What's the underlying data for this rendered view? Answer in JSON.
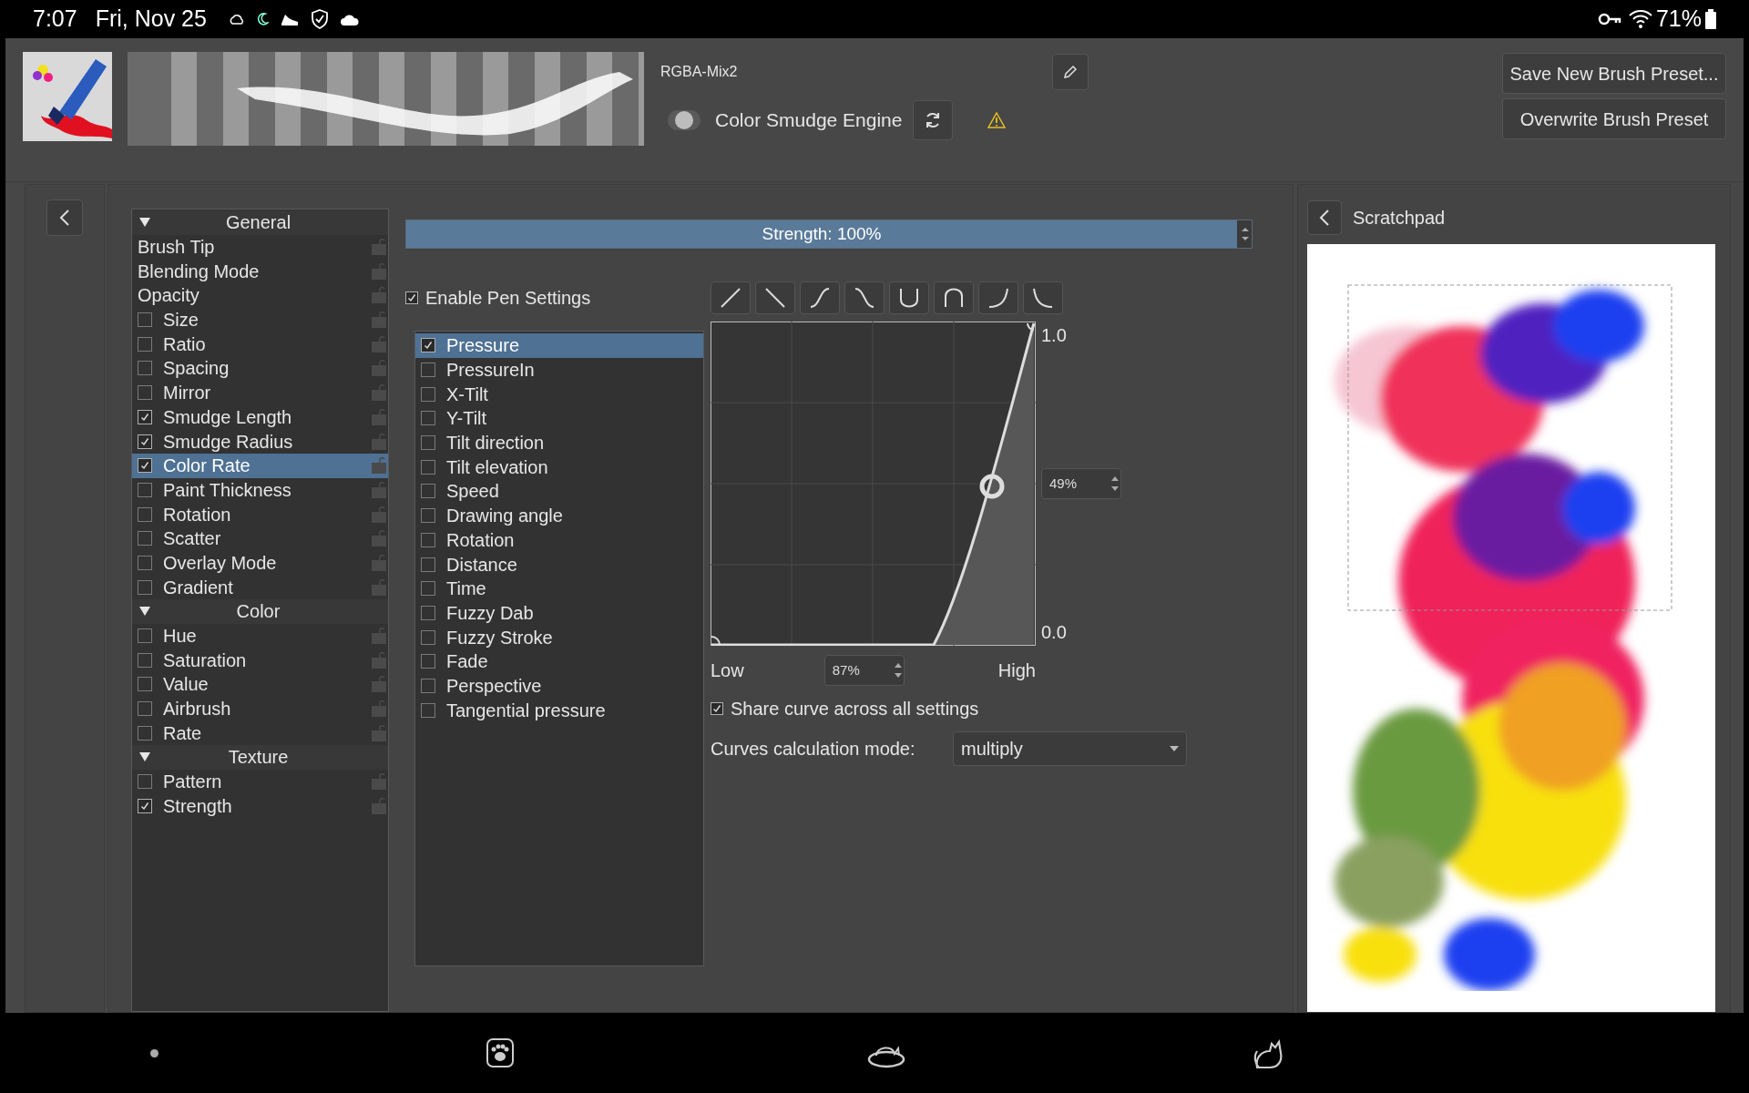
{
  "status_bar": {
    "time": "7:07",
    "date": "Fri, Nov 25",
    "battery": "71%"
  },
  "toolbar": {
    "preset_name": "RGBA-Mix2",
    "engine": {
      "label": "Color Smudge Engine",
      "on": false
    },
    "save_new": "Save New Brush Preset...",
    "overwrite": "Overwrite Brush Preset"
  },
  "options": [
    {
      "title": "General",
      "expanded": true,
      "items": [
        {
          "label": "Brush Tip",
          "kind": "plain",
          "selected": false
        },
        {
          "label": "Blending Mode",
          "kind": "plain",
          "selected": false
        },
        {
          "label": "Opacity",
          "kind": "plain",
          "selected": false
        },
        {
          "label": "Size",
          "kind": "checkbox",
          "checked": false,
          "selected": false
        },
        {
          "label": "Ratio",
          "kind": "checkbox",
          "checked": false,
          "selected": false
        },
        {
          "label": "Spacing",
          "kind": "checkbox",
          "checked": false,
          "selected": false
        },
        {
          "label": "Mirror",
          "kind": "checkbox",
          "checked": false,
          "selected": false
        },
        {
          "label": "Smudge Length",
          "kind": "checkbox",
          "checked": true,
          "selected": false
        },
        {
          "label": "Smudge Radius",
          "kind": "checkbox",
          "checked": true,
          "selected": false
        },
        {
          "label": "Color Rate",
          "kind": "checkbox",
          "checked": true,
          "selected": true
        },
        {
          "label": "Paint Thickness",
          "kind": "checkbox",
          "checked": false,
          "selected": false
        },
        {
          "label": "Rotation",
          "kind": "checkbox",
          "checked": false,
          "selected": false
        },
        {
          "label": "Scatter",
          "kind": "checkbox",
          "checked": false,
          "selected": false
        },
        {
          "label": "Overlay Mode",
          "kind": "checkbox",
          "checked": false,
          "selected": false
        },
        {
          "label": "Gradient",
          "kind": "checkbox",
          "checked": false,
          "selected": false
        }
      ]
    },
    {
      "title": "Color",
      "expanded": true,
      "items": [
        {
          "label": "Hue",
          "kind": "checkbox",
          "checked": false,
          "selected": false
        },
        {
          "label": "Saturation",
          "kind": "checkbox",
          "checked": false,
          "selected": false
        },
        {
          "label": "Value",
          "kind": "checkbox",
          "checked": false,
          "selected": false
        },
        {
          "label": "Airbrush",
          "kind": "checkbox",
          "checked": false,
          "selected": false
        },
        {
          "label": "Rate",
          "kind": "checkbox",
          "checked": false,
          "selected": false
        }
      ]
    },
    {
      "title": "Texture",
      "expanded": true,
      "items": [
        {
          "label": "Pattern",
          "kind": "checkbox",
          "checked": false,
          "selected": false
        },
        {
          "label": "Strength",
          "kind": "checkbox",
          "checked": true,
          "selected": false
        }
      ]
    }
  ],
  "strength": {
    "label": "Strength: 100%",
    "level": 1
  },
  "pen_settings": {
    "label": "Enable Pen Settings",
    "checked": true
  },
  "sensors": [
    {
      "label": "Pressure",
      "checked": true,
      "selected": true
    },
    {
      "label": "PressureIn",
      "checked": false,
      "selected": false
    },
    {
      "label": "X-Tilt",
      "checked": false,
      "selected": false
    },
    {
      "label": "Y-Tilt",
      "checked": false,
      "selected": false
    },
    {
      "label": "Tilt direction",
      "checked": false,
      "selected": false
    },
    {
      "label": "Tilt elevation",
      "checked": false,
      "selected": false
    },
    {
      "label": "Speed",
      "checked": false,
      "selected": false
    },
    {
      "label": "Drawing angle",
      "checked": false,
      "selected": false
    },
    {
      "label": "Rotation",
      "checked": false,
      "selected": false
    },
    {
      "label": "Distance",
      "checked": false,
      "selected": false
    },
    {
      "label": "Time",
      "checked": false,
      "selected": false
    },
    {
      "label": "Fuzzy Dab",
      "checked": false,
      "selected": false
    },
    {
      "label": "Fuzzy Stroke",
      "checked": false,
      "selected": false
    },
    {
      "label": "Fade",
      "checked": false,
      "selected": false
    },
    {
      "label": "Perspective",
      "checked": false,
      "selected": false
    },
    {
      "label": "Tangential pressure",
      "checked": false,
      "selected": false
    }
  ],
  "curve": {
    "y_max": "1.0",
    "y_min": "0.0",
    "point_value": "49%",
    "low": "Low",
    "high": "High",
    "low_value": "87%"
  },
  "share_curve": {
    "label": "Share curve across all settings",
    "checked": true
  },
  "calc_mode": {
    "label": "Curves calculation mode:",
    "value": "multiply"
  },
  "scratchpad": {
    "title": "Scratchpad"
  }
}
